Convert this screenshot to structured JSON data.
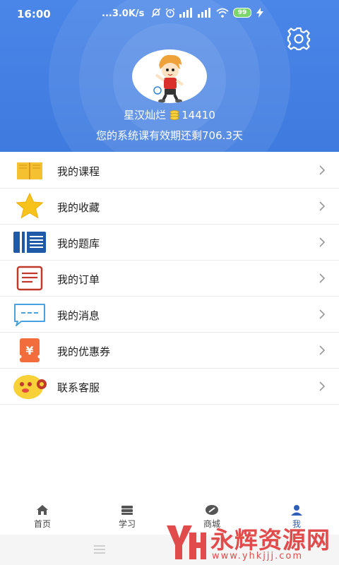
{
  "status_bar": {
    "time": "16:00",
    "net_speed": "...3.0K/s",
    "battery": "99"
  },
  "profile": {
    "username": "星汉灿烂",
    "coins": "14410",
    "validity": "您的系统课有效期还剩706.3天"
  },
  "menu": [
    {
      "label": "我的课程",
      "icon": "book-icon"
    },
    {
      "label": "我的收藏",
      "icon": "star-icon"
    },
    {
      "label": "我的题库",
      "icon": "question-bank-icon"
    },
    {
      "label": "我的订单",
      "icon": "order-icon"
    },
    {
      "label": "我的消息",
      "icon": "message-icon"
    },
    {
      "label": "我的优惠券",
      "icon": "coupon-icon"
    },
    {
      "label": "联系客服",
      "icon": "customer-service-icon"
    }
  ],
  "tabs": [
    {
      "label": "首页",
      "icon": "home-icon"
    },
    {
      "label": "学习",
      "icon": "study-icon"
    },
    {
      "label": "商城",
      "icon": "mall-icon"
    },
    {
      "label": "我",
      "icon": "profile-icon",
      "active": true
    }
  ],
  "watermark": {
    "text": "永辉资源网",
    "url": "www.yhkjjj.com"
  },
  "colors": {
    "header": "#4a86e8",
    "active_tab": "#2f5fb8",
    "watermark": "#e24b4b"
  }
}
